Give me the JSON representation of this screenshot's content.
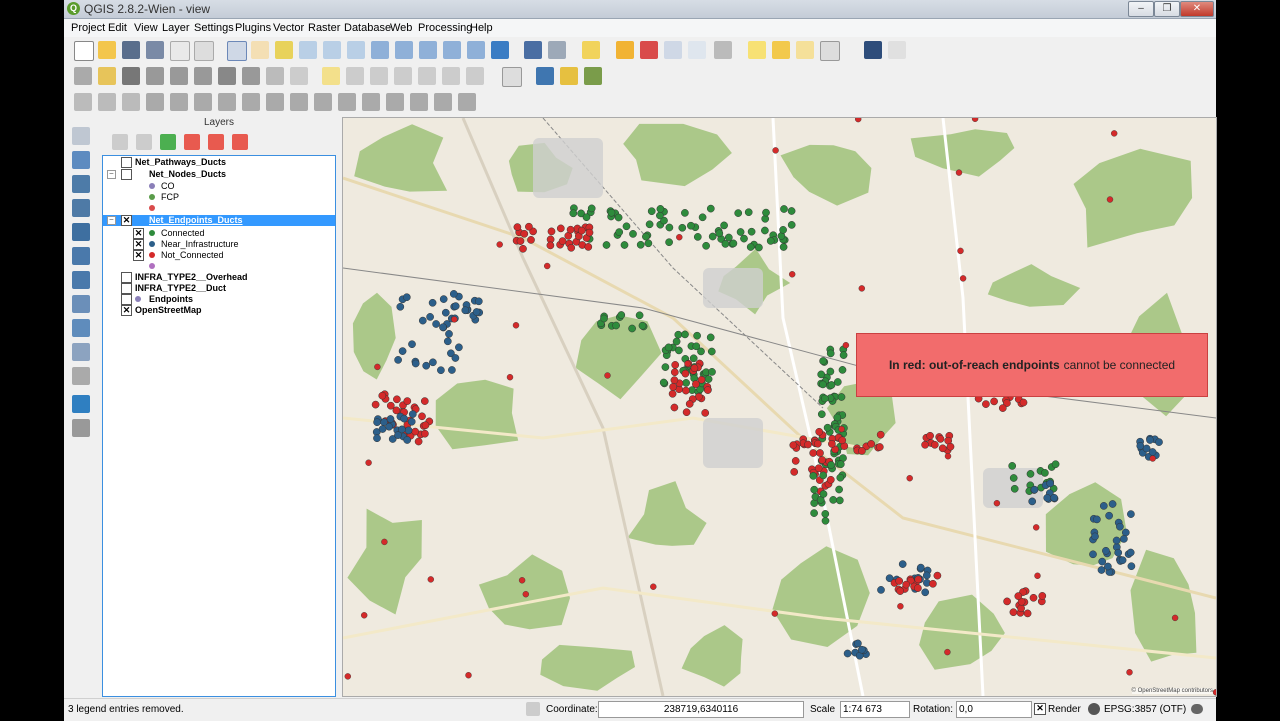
{
  "window": {
    "title": "QGIS 2.8.2-Wien - view",
    "app_icon": "qgis-icon"
  },
  "menu": [
    "Project",
    "Edit",
    "View",
    "Layer",
    "Settings",
    "Plugins",
    "Vector",
    "Raster",
    "Database",
    "Web",
    "Processing",
    "Help"
  ],
  "layers_panel": {
    "title": "Layers",
    "items": [
      {
        "label": "Net_Pathways_Ducts",
        "checked": false
      },
      {
        "label": "Net_Nodes_Ducts",
        "checked": false
      },
      {
        "label": "CO",
        "color": "#8a7fb8"
      },
      {
        "label": "FCP",
        "color": "#5a9c4a"
      },
      {
        "label": "",
        "color": "#d94b4b"
      },
      {
        "label": "Net_Endpoints_Ducts",
        "checked": true,
        "selected": true
      },
      {
        "label": "Connected",
        "checked": true,
        "color": "#2e8b3c"
      },
      {
        "label": "Near_Infrastructure",
        "checked": true,
        "color": "#2c5f8a"
      },
      {
        "label": "Not_Connected",
        "checked": true,
        "color": "#d42a2a"
      },
      {
        "label": "",
        "color": "#b070c0"
      },
      {
        "label": "INFRA_TYPE2__Overhead",
        "checked": false
      },
      {
        "label": "INFRA_TYPE2__Duct",
        "checked": false
      },
      {
        "label": "Endpoints",
        "checked": false,
        "color": "#8a7fb8"
      },
      {
        "label": "OpenStreetMap",
        "checked": true
      }
    ]
  },
  "map": {
    "callout_bold": "In red: out-of-reach endpoints",
    "callout_rest": "cannot be connected",
    "credit": "© OpenStreetMap contributors"
  },
  "status": {
    "message": "3 legend entries removed.",
    "coordinate_label": "Coordinate:",
    "coordinate": "238719,6340116",
    "scale_label": "Scale",
    "scale": "1:74 673",
    "rotation_label": "Rotation:",
    "rotation": "0,0",
    "render_label": "Render",
    "render_checked": true,
    "crs": "EPSG:3857 (OTF)"
  },
  "colors": {
    "connected": "#2e8b3c",
    "near": "#2c5f8a",
    "not_connected": "#d42a2a",
    "forest": "#9fc27a",
    "callout": "#f26c6c"
  }
}
